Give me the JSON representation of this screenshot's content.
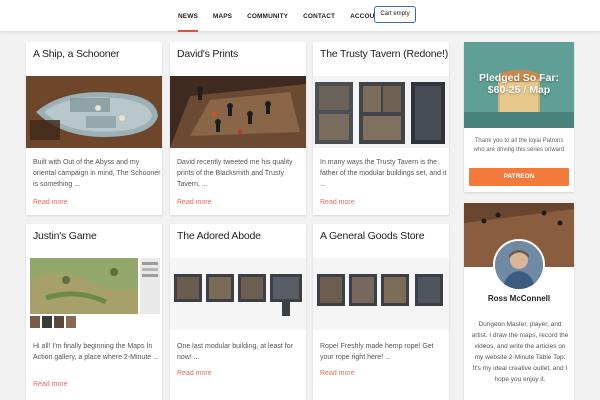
{
  "nav": {
    "items": [
      "NEWS",
      "MAPS",
      "COMMUNITY",
      "CONTACT",
      "ACCOUNT"
    ],
    "active": "NEWS",
    "cart_label": "Cart empty"
  },
  "posts": [
    {
      "title": "A Ship, a Schooner",
      "excerpt": "Built with Out of the Abyss and my oriental campaign in mind, The Schooner is something ...",
      "read_more": "Read more"
    },
    {
      "title": "David's Prints",
      "excerpt": "David recently tweeted me his quality prints of the Blacksmith and Trusty Tavern, ...",
      "read_more": "Read more"
    },
    {
      "title": "The Trusty Tavern (Redone!)",
      "excerpt": "In many ways the Trusty Tavern is the father of the modular buildings set, and it ...",
      "read_more": "Read more"
    },
    {
      "title": "Justin's Game",
      "excerpt": "Hi all! I'm finally beginning the Maps In Action gallery, a place where 2-Minute ...",
      "read_more": "Read more"
    },
    {
      "title": "The Adored Abode",
      "excerpt": "One last modular building, at least for now! ...",
      "read_more": "Read more"
    },
    {
      "title": "A General Goods Store",
      "excerpt": "Rope! Freshly made hemp rope! Get your rope right here! ...",
      "read_more": "Read more"
    }
  ],
  "sidebar": {
    "pledge": {
      "line1": "Pledged So Far:",
      "line2": "$60-25 / Map",
      "thanks": "Thank you to all the loyal Patrons who are driving this series onward",
      "button": "PATREON",
      "banner_color": "#5f9f96",
      "button_color": "#f27b3c"
    },
    "profile": {
      "name": "Ross McConnell",
      "bio": "Dungeon Master, player, and artist. I draw the maps, record the videos, and write the articles on my website 2-Minute Table Top. It's my ideal creative outlet, and I hope you enjoy it."
    }
  },
  "colors": {
    "accent": "#e64c3c",
    "read_more": "#e36b5c"
  }
}
